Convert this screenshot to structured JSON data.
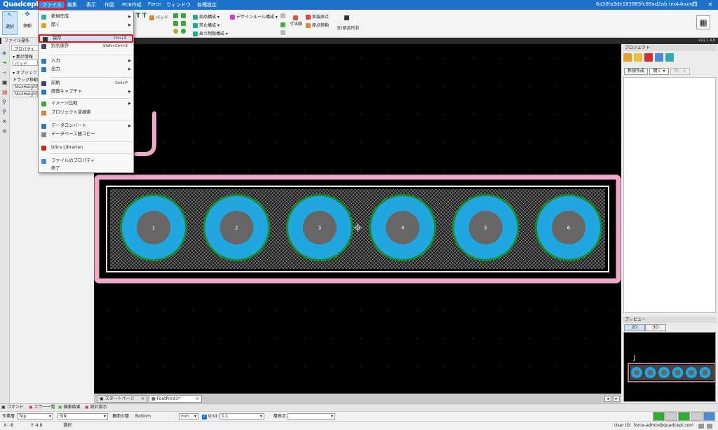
{
  "app": {
    "logo": "Quadcept",
    "document_id": "6a30fa3de183885fc89ad2ab (not found)",
    "version": "v11.1.4.0"
  },
  "menubar": [
    "ファイル",
    "編集",
    "表示",
    "作図",
    "PCB作成",
    "Force",
    "ウィンドウ",
    "各種設定"
  ],
  "ribbon": {
    "select": "選択",
    "move": "移動",
    "pad": "パッド",
    "part_edit": "部品構成",
    "forbidden_edit": "禁止構成",
    "height_limit_edit": "高さ制限構成",
    "design_rule_edit": "デザインルール構成",
    "mount_origin": "実装原点",
    "origin_move": "原点移動",
    "dimension": "寸法線",
    "shape_3d": "3D部品形状"
  },
  "file_menu": {
    "items": [
      {
        "label": "新規作成",
        "shortcut": "",
        "submenu": true,
        "icon": "new-icon"
      },
      {
        "label": "開く",
        "shortcut": "",
        "submenu": true,
        "icon": "open-icon"
      },
      {
        "label": "保存",
        "shortcut": "Ctrl+S",
        "submenu": false,
        "icon": "save-icon"
      },
      {
        "label": "別名保存",
        "shortcut": "Shift+Ctrl+S",
        "submenu": false,
        "icon": "save-as-icon"
      },
      {
        "label": "入力",
        "shortcut": "",
        "submenu": true,
        "icon": "import-icon"
      },
      {
        "label": "出力",
        "shortcut": "",
        "submenu": true,
        "icon": "export-icon"
      },
      {
        "label": "印刷",
        "shortcut": "Ctrl+P",
        "submenu": false,
        "icon": "print-icon"
      },
      {
        "label": "画面キャプチャ",
        "shortcut": "",
        "submenu": true,
        "icon": "capture-icon"
      },
      {
        "label": "イメージ比較",
        "shortcut": "",
        "submenu": true,
        "icon": "compare-icon"
      },
      {
        "label": "プロジェクト逆検索",
        "shortcut": "",
        "submenu": false,
        "icon": "search-icon"
      },
      {
        "label": "データコンバート",
        "shortcut": "",
        "submenu": true,
        "icon": "convert-icon"
      },
      {
        "label": "データベース間コピー",
        "shortcut": "",
        "submenu": false,
        "icon": "db-copy-icon"
      },
      {
        "label": "Ultra Librarian",
        "shortcut": "",
        "submenu": false,
        "icon": "ultra-librarian-icon"
      },
      {
        "label": "ファイルのプロパティ",
        "shortcut": "",
        "submenu": false,
        "icon": "properties-icon"
      },
      {
        "label": "終了",
        "shortcut": "",
        "submenu": false,
        "icon": ""
      }
    ]
  },
  "left_panel": {
    "tab_file": "ファイル操作",
    "tab_property": "プロパティ",
    "section_design": "集計情報",
    "object_value": "パッド",
    "section_object": "オブジェクト",
    "drag_move": "ドラッグ移動",
    "rows": [
      "MaxHeightT",
      "MaxHeight"
    ]
  },
  "pads": [
    "1",
    "2",
    "3",
    "4",
    "5",
    "6"
  ],
  "right_panel": {
    "project_title": "プロジェクト",
    "new_button": "新規作成",
    "open_button": "開く",
    "close_button": "閉じる",
    "preview_title": "プレビュー",
    "tab_2d": "2D",
    "tab_3d": "3D"
  },
  "doc_tabs": [
    "スタートページ",
    "FootPrint1*"
  ],
  "bottom_tabs": [
    "コマンド",
    "エラー一覧",
    "検索結果",
    "設計指示"
  ],
  "statusbar": {
    "work_layer_label": "作業層",
    "work_layer": "Top",
    "layer_value": "Silk",
    "back_side_label": "裏面の層：",
    "back_side_value": "Bottom",
    "unit": "mm",
    "grid_label": "Grid",
    "grid_value": "0.1",
    "display_label": "層表示",
    "x": "X: -8",
    "y": "Y: 4.8",
    "mode": "選択",
    "user": "User ID：force-admin@quadcept.com"
  },
  "colors": {
    "title": "#1c73c9",
    "pad": "#22a6e0",
    "hole": "#666666",
    "outline": "#f0a8c8",
    "ring": "#1a8a30"
  }
}
